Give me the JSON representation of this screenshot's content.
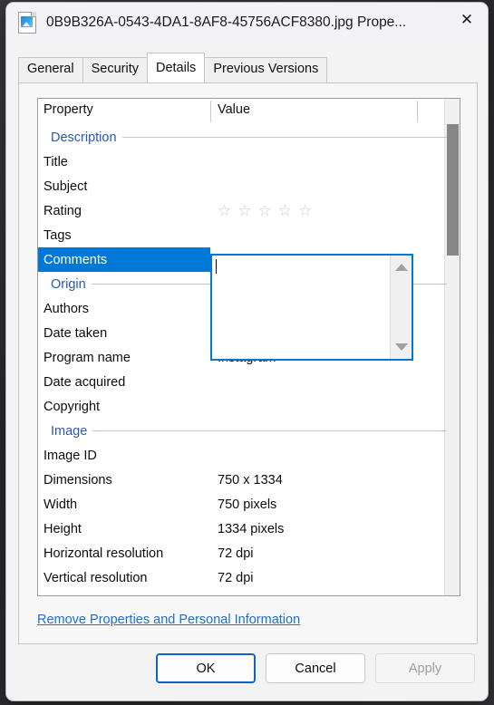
{
  "window": {
    "title": "0B9B326A-0543-4DA1-8AF8-45756ACF8380.jpg Prope...",
    "file_icon": "image-file-icon",
    "close_icon": "✕"
  },
  "tabs": [
    {
      "label": "General",
      "active": false
    },
    {
      "label": "Security",
      "active": false
    },
    {
      "label": "Details",
      "active": true
    },
    {
      "label": "Previous Versions",
      "active": false
    }
  ],
  "list": {
    "headers": {
      "property": "Property",
      "value": "Value"
    },
    "rows": [
      {
        "type": "section",
        "name": "Description"
      },
      {
        "type": "item",
        "name": "Title",
        "value": ""
      },
      {
        "type": "item",
        "name": "Subject",
        "value": ""
      },
      {
        "type": "rating",
        "name": "Rating",
        "value": "",
        "stars": 5,
        "filled": 0,
        "star_glyph": "☆"
      },
      {
        "type": "item",
        "name": "Tags",
        "value": ""
      },
      {
        "type": "item",
        "name": "Comments",
        "value": "",
        "selected": true
      },
      {
        "type": "section",
        "name": "Origin"
      },
      {
        "type": "item",
        "name": "Authors",
        "value": ""
      },
      {
        "type": "item",
        "name": "Date taken",
        "value": ""
      },
      {
        "type": "item",
        "name": "Program name",
        "value": "Instagram"
      },
      {
        "type": "item",
        "name": "Date acquired",
        "value": ""
      },
      {
        "type": "item",
        "name": "Copyright",
        "value": ""
      },
      {
        "type": "section",
        "name": "Image"
      },
      {
        "type": "item",
        "name": "Image ID",
        "value": ""
      },
      {
        "type": "item",
        "name": "Dimensions",
        "value": "750 x 1334"
      },
      {
        "type": "item",
        "name": "Width",
        "value": "750 pixels"
      },
      {
        "type": "item",
        "name": "Height",
        "value": "1334 pixels"
      },
      {
        "type": "item",
        "name": "Horizontal resolution",
        "value": "72 dpi"
      },
      {
        "type": "item",
        "name": "Vertical resolution",
        "value": "72 dpi"
      }
    ]
  },
  "comment_editor": {
    "value": "",
    "scroll_up_icon": "▲",
    "scroll_down_icon": "▼"
  },
  "privacy_link": "Remove Properties and Personal Information",
  "buttons": {
    "ok": "OK",
    "cancel": "Cancel",
    "apply": "Apply"
  },
  "colors": {
    "selection": "#0078d7",
    "section_text": "#2a58b8",
    "link": "#1f6fd0"
  }
}
